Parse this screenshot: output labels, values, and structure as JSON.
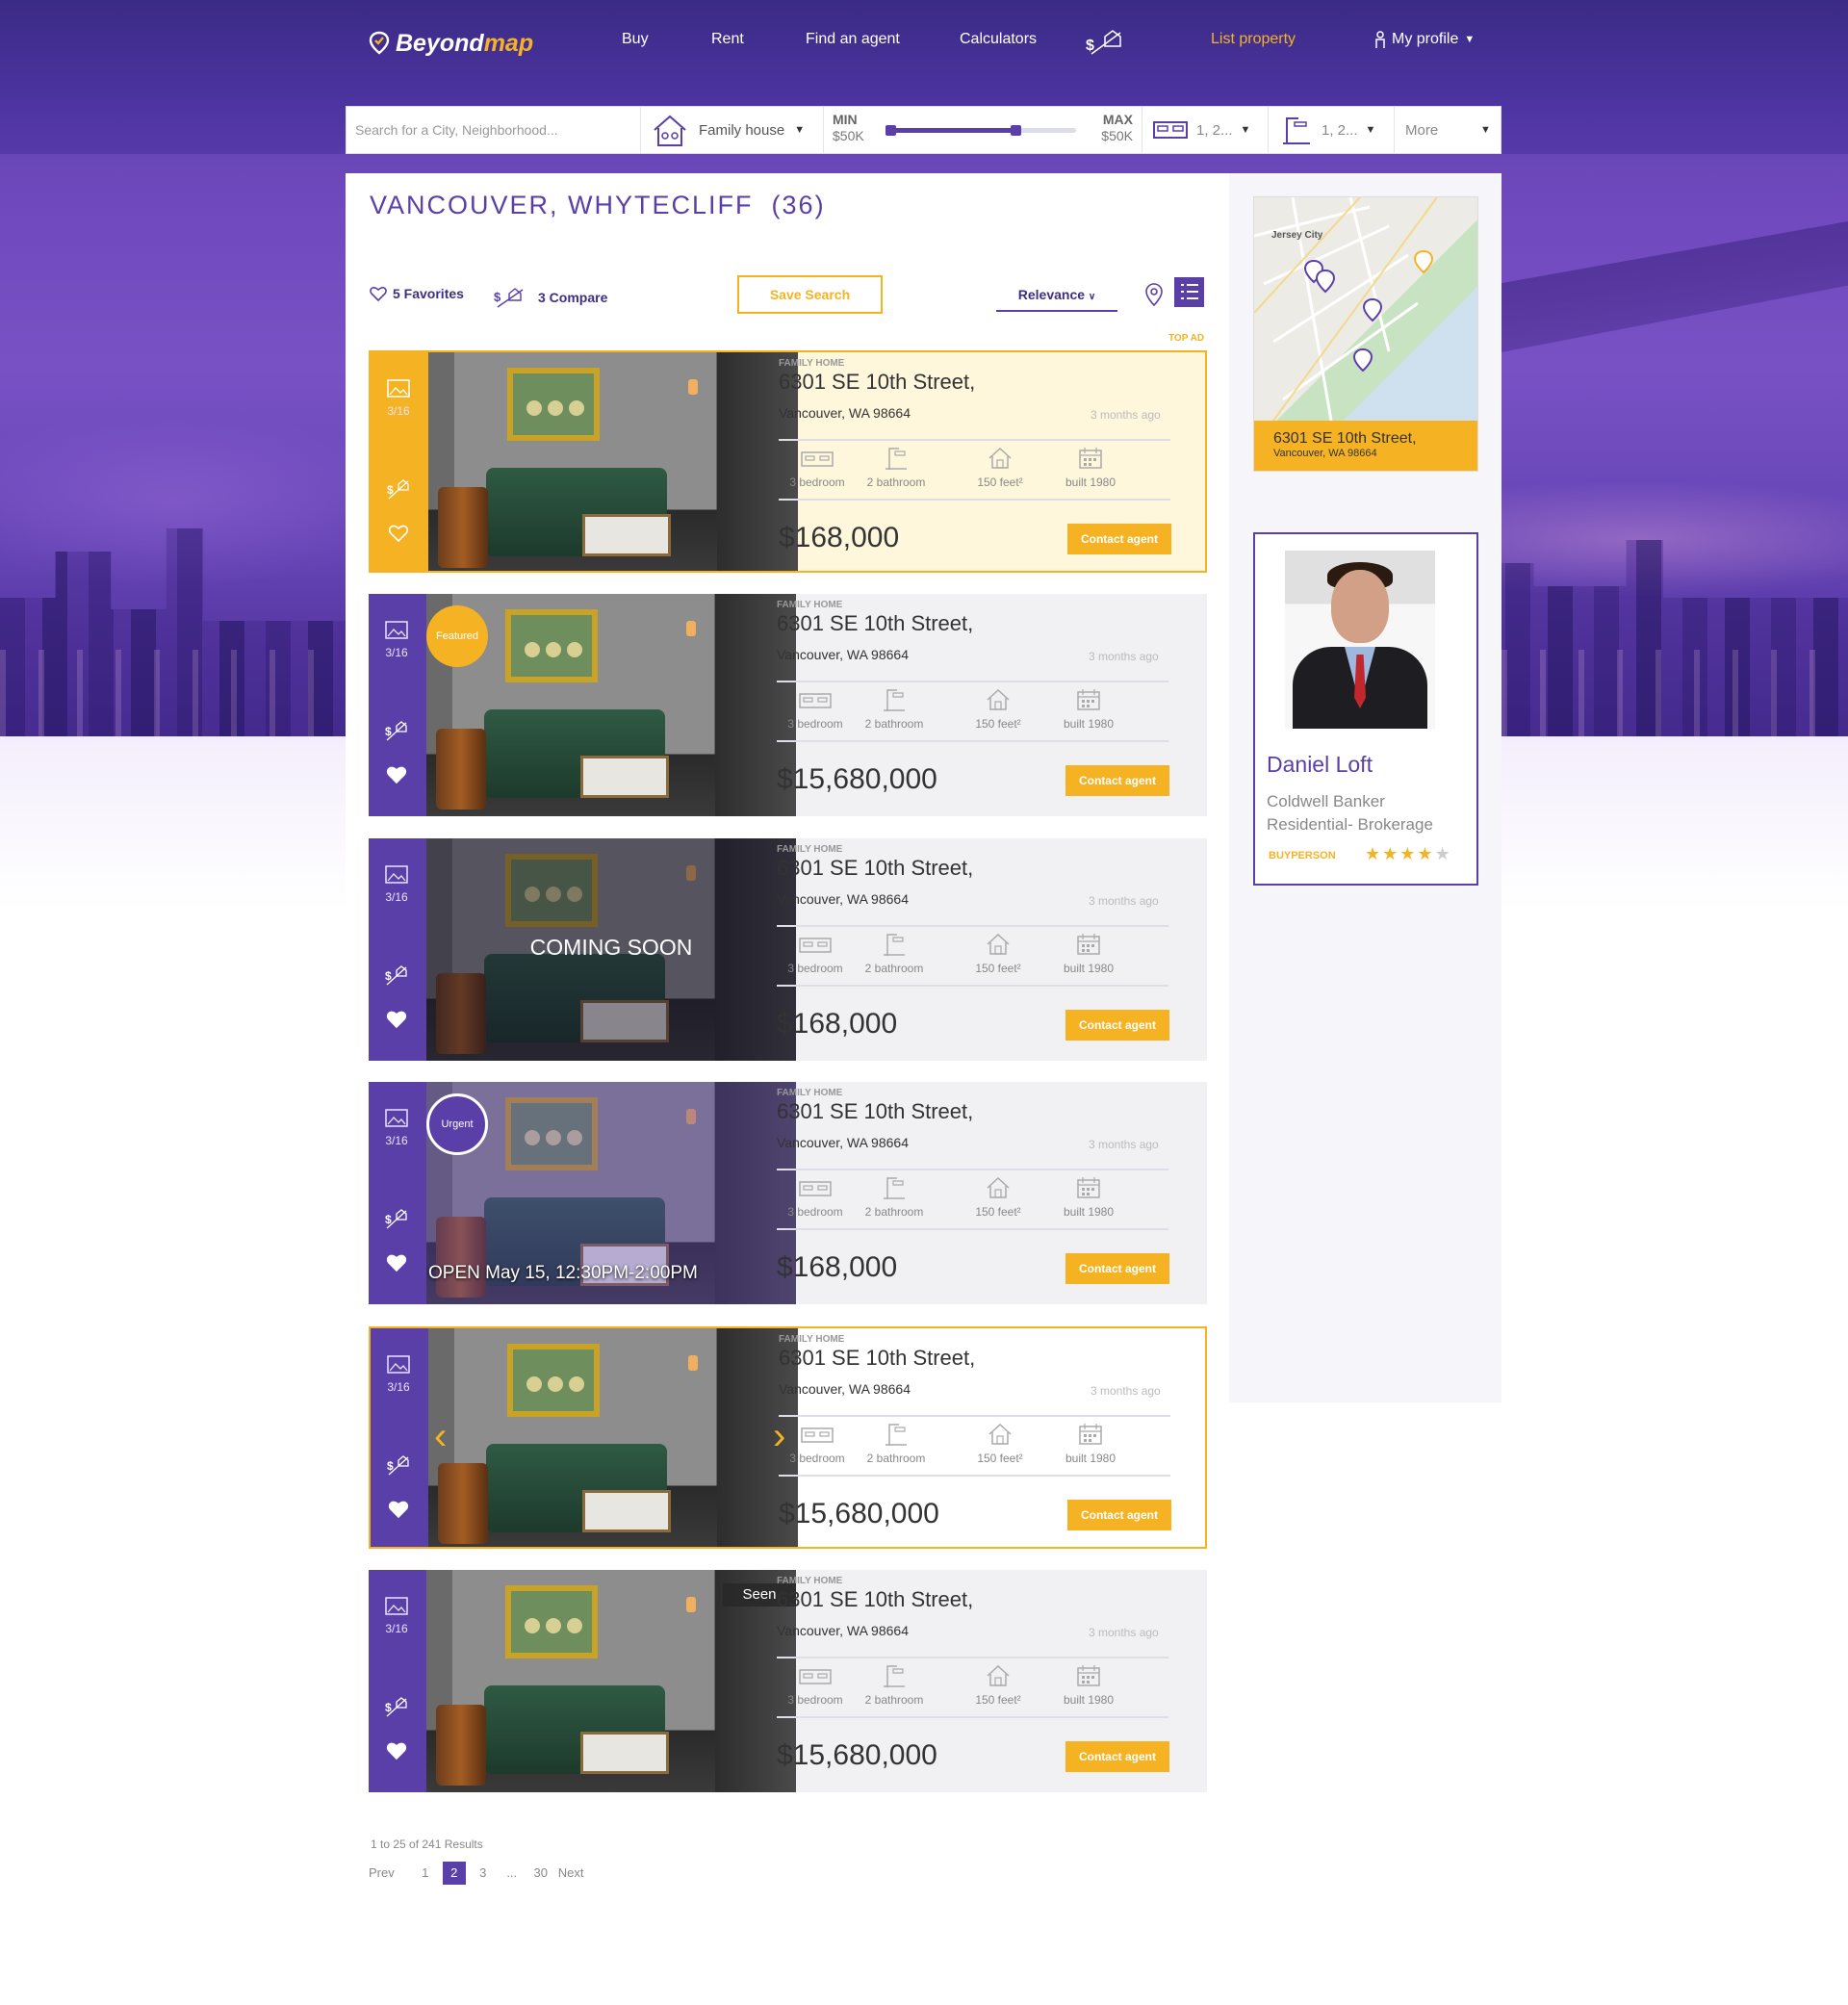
{
  "brand": {
    "name_a": "Beyond",
    "name_b": "map"
  },
  "nav": {
    "buy": "Buy",
    "rent": "Rent",
    "find_agent": "Find an agent",
    "calculators": "Calculators",
    "list_property": "List property",
    "profile": "My profile"
  },
  "search": {
    "placeholder": "Search for a City, Neighborhood...",
    "type": "Family house",
    "min_label": "MIN",
    "min_value": "$50K",
    "max_label": "MAX",
    "max_value": "$50K",
    "price_range_fraction": [
      0.0,
      0.68
    ],
    "beds": "1, 2...",
    "baths": "1, 2...",
    "more": "More"
  },
  "results": {
    "title": "VANCOUVER, WHYTECLIFF",
    "count": "(36)",
    "favorites": "5 Favorites",
    "compare": "3 Compare",
    "save_search": "Save Search",
    "sort": "Relevance",
    "top_ad": "TOP AD"
  },
  "listings": [
    {
      "type": "FAMILY HOME",
      "street": "6301 SE 10th Street,",
      "city": "Vancouver, WA 98664",
      "ago": "3 months ago",
      "bed": "3 bedroom",
      "bath": "2 bathroom",
      "area": "150 feet²",
      "built": "built 1980",
      "price": "$168,000",
      "contact": "Contact agent",
      "photos": "3/16"
    },
    {
      "type": "FAMILY HOME",
      "street": "6301 SE 10th Street,",
      "city": "Vancouver, WA 98664",
      "ago": "3 months ago",
      "bed": "3 bedroom",
      "bath": "2 bathroom",
      "area": "150 feet²",
      "built": "built 1980",
      "price": "$15,680,000",
      "contact": "Contact agent",
      "photos": "3/16",
      "badge": "Featured"
    },
    {
      "type": "FAMILY HOME",
      "street": "6301 SE 10th Street,",
      "city": "Vancouver, WA 98664",
      "ago": "3 months ago",
      "bed": "3 bedroom",
      "bath": "2 bathroom",
      "area": "150 feet²",
      "built": "built 1980",
      "price": "$168,000",
      "contact": "Contact agent",
      "photos": "3/16",
      "overlay": "COMING SOON"
    },
    {
      "type": "FAMILY HOME",
      "street": "6301 SE 10th Street,",
      "city": "Vancouver, WA 98664",
      "ago": "3 months ago",
      "bed": "3 bedroom",
      "bath": "2 bathroom",
      "area": "150 feet²",
      "built": "built 1980",
      "price": "$168,000",
      "contact": "Contact agent",
      "photos": "3/16",
      "badge": "Urgent",
      "open": "OPEN May 15,  12:30PM-2:00PM"
    },
    {
      "type": "FAMILY HOME",
      "street": "6301 SE 10th Street,",
      "city": "Vancouver, WA 98664",
      "ago": "3 months ago",
      "bed": "3 bedroom",
      "bath": "2 bathroom",
      "area": "150 feet²",
      "built": "built 1980",
      "price": "$15,680,000",
      "contact": "Contact agent",
      "photos": "3/16"
    },
    {
      "type": "FAMILY HOME",
      "street": "6301 SE 10th Street,",
      "city": "Vancouver, WA 98664",
      "ago": "3 months ago",
      "bed": "3 bedroom",
      "bath": "2 bathroom",
      "area": "150 feet²",
      "built": "built 1980",
      "price": "$15,680,000",
      "contact": "Contact agent",
      "photos": "3/16",
      "seen": "Seen"
    }
  ],
  "map": {
    "street": "6301 SE 10th Street,",
    "city": "Vancouver, WA 98664",
    "place": "Jersey City"
  },
  "agent": {
    "name": "Daniel Loft",
    "company": "Coldwell Banker Residential- Brokerage",
    "role": "BUYPERSON",
    "rating": 4,
    "rating_max": 5
  },
  "pagination": {
    "summary": "1 to 25 of 241 Results",
    "prev": "Prev",
    "pages": [
      "1",
      "2",
      "3",
      "...",
      "30"
    ],
    "current": "2",
    "next": "Next"
  },
  "colors": {
    "purple": "#5b3fa8",
    "gold": "#f5b324"
  }
}
